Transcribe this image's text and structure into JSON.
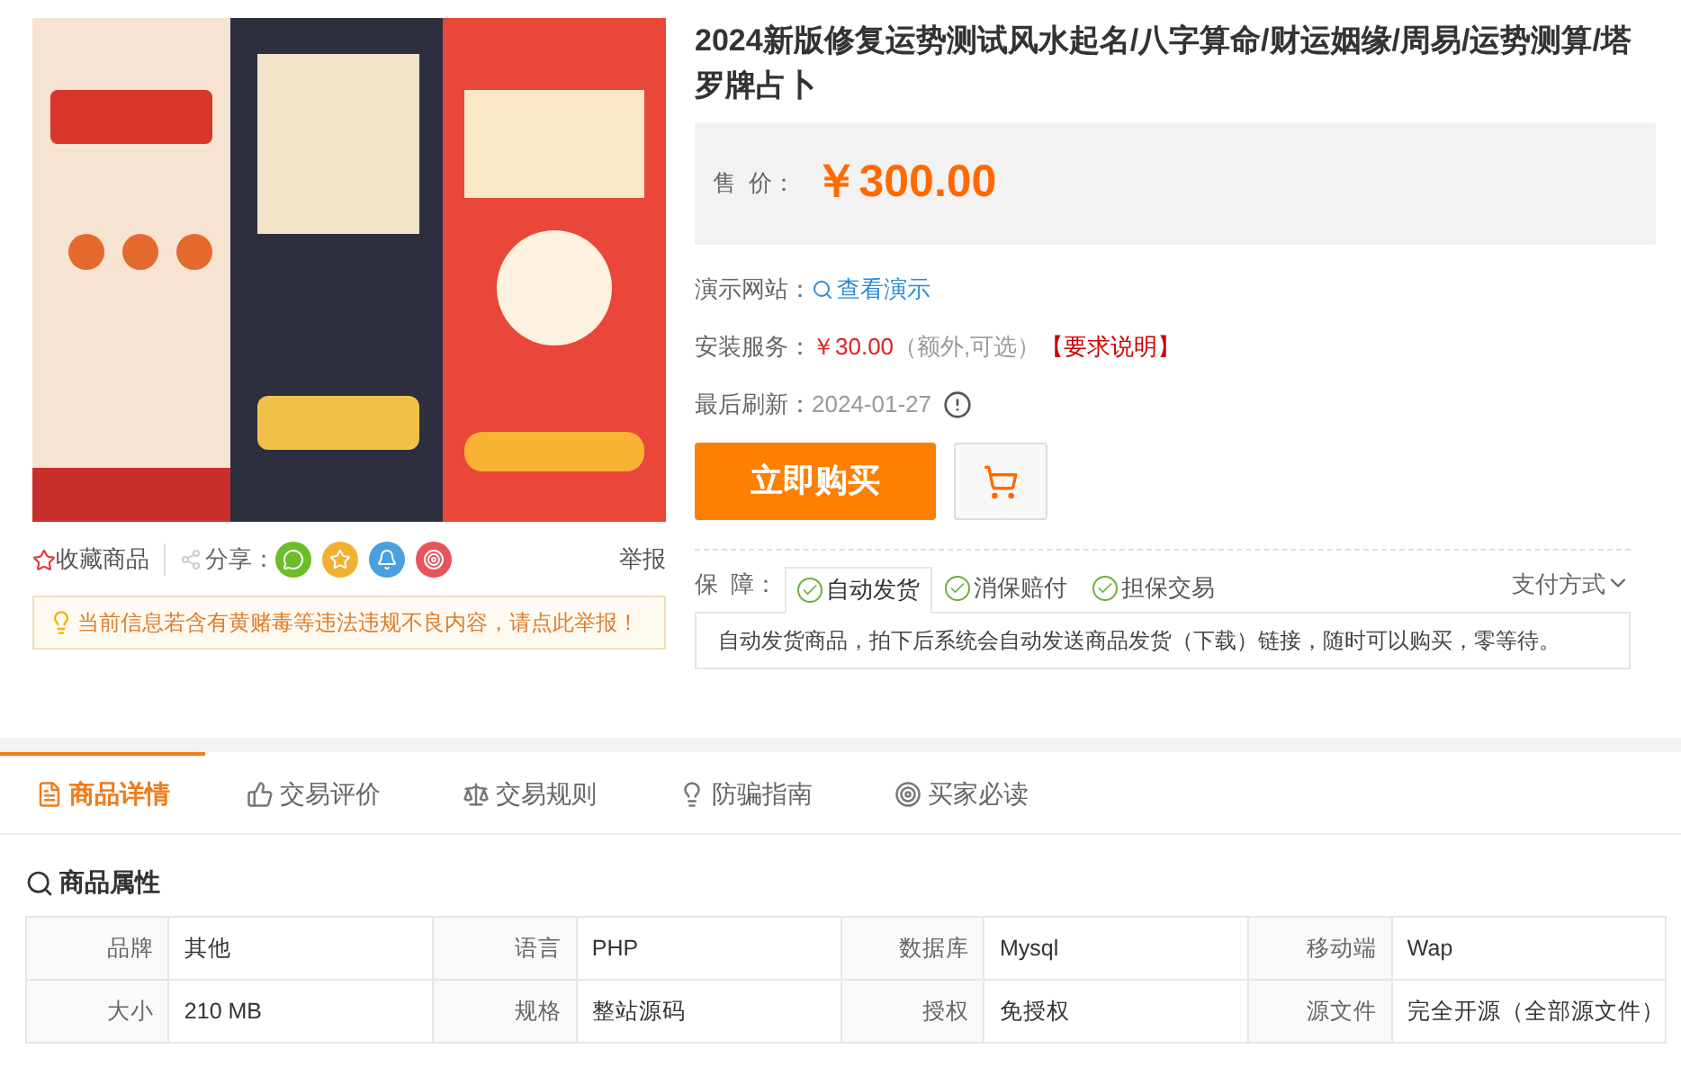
{
  "product": {
    "title": "2024新版修复运势测试风水起名/八字算命/财运姻缘/周易/运势测算/塔罗牌占卜",
    "price_label": "售  价：",
    "price": "￥300.00",
    "demo_label": "演示网站：",
    "demo_link": "查看演示",
    "install_label": "安装服务：",
    "install_price": "￥30.00",
    "install_note": "（额外,可选）",
    "install_link": "【要求说明】",
    "refresh_label": "最后刷新：",
    "refresh_date": "2024-01-27",
    "buy_button": "立即购买",
    "guarantee_label": "保  障：",
    "guarantees": [
      {
        "label": "自动发货",
        "selected": true
      },
      {
        "label": "消保赔付",
        "selected": false
      },
      {
        "label": "担保交易",
        "selected": false
      }
    ],
    "payment": "支付方式",
    "guarantee_text": "自动发货商品，拍下后系统会自动发送商品发货（下载）链接，随时可以购买，零等待。"
  },
  "actions": {
    "favorite": "收藏商品",
    "share_label": "分享：",
    "share_icons": [
      {
        "kind": "wechat",
        "color": "#6bbd2a"
      },
      {
        "kind": "favorite",
        "color": "#f1b12f"
      },
      {
        "kind": "qq",
        "color": "#4a9fe0"
      },
      {
        "kind": "weibo",
        "color": "#e8545c"
      }
    ],
    "report": "举报"
  },
  "notice": "当前信息若含有黄赌毒等违法违规不良内容，请点此举报！",
  "tabs": [
    {
      "label": "商品详情",
      "selected": true,
      "kind": "detail"
    },
    {
      "label": "交易评价",
      "selected": false,
      "kind": "thumb"
    },
    {
      "label": "交易规则",
      "selected": false,
      "kind": "scale"
    },
    {
      "label": "防骗指南",
      "selected": false,
      "kind": "bulb"
    },
    {
      "label": "买家必读",
      "selected": false,
      "kind": "target"
    }
  ],
  "attributes": {
    "title": "商品属性",
    "rows": [
      [
        {
          "name": "品牌",
          "value": "其他"
        },
        {
          "name": "语言",
          "value": "PHP"
        },
        {
          "name": "数据库",
          "value": "Mysql"
        },
        {
          "name": "移动端",
          "value": "Wap"
        }
      ],
      [
        {
          "name": "大小",
          "value": "210 MB"
        },
        {
          "name": "规格",
          "value": "整站源码"
        },
        {
          "name": "授权",
          "value": "免授权"
        },
        {
          "name": "源文件",
          "value": "完全开源（全部源文件）"
        }
      ]
    ]
  }
}
